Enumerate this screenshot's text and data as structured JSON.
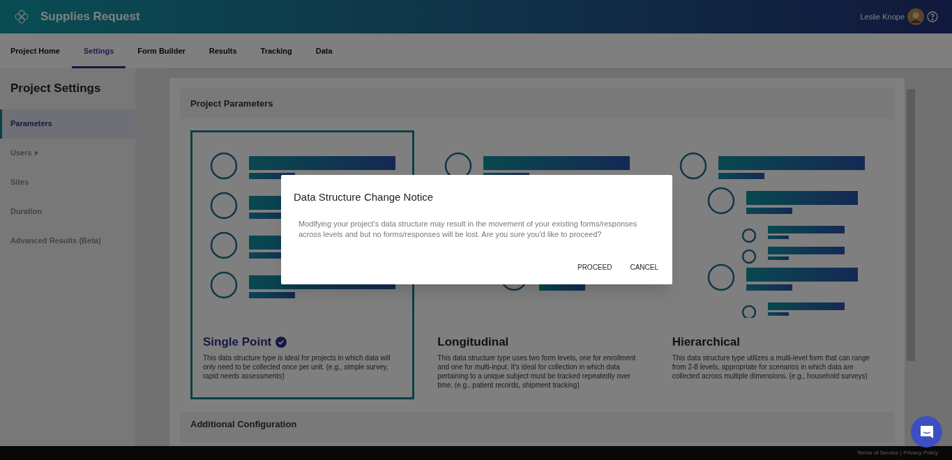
{
  "app": {
    "title": "Supplies Request",
    "user": "Leslie Knope"
  },
  "tabs": [
    {
      "label": "Project Home",
      "selected": false
    },
    {
      "label": "Settings",
      "selected": true
    },
    {
      "label": "Form Builder",
      "selected": false
    },
    {
      "label": "Results",
      "selected": false
    },
    {
      "label": "Tracking",
      "selected": false
    },
    {
      "label": "Data",
      "selected": false
    }
  ],
  "sidebar": {
    "title": "Project Settings",
    "items": [
      {
        "label": "Parameters",
        "selected": true,
        "has_submenu": false
      },
      {
        "label": "Users",
        "selected": false,
        "has_submenu": true
      },
      {
        "label": "Sites",
        "selected": false,
        "has_submenu": false
      },
      {
        "label": "Duration",
        "selected": false,
        "has_submenu": false
      },
      {
        "label": "Advanced Results (Beta)",
        "selected": false,
        "has_submenu": false
      }
    ]
  },
  "section_title": "Project Parameters",
  "structures": [
    {
      "kind": "single",
      "title": "Single Point",
      "selected": true,
      "description": "This data structure type is ideal for projects in which data will only need to be collected once per unit. (e.g., simple survey, rapid needs assessments)"
    },
    {
      "kind": "longitudinal",
      "title": "Longitudinal",
      "selected": false,
      "description": "This data structure type uses two form levels, one for enrollment and one for multi-input. It's ideal for collection in which data pertaining to a unique subject must be tracked repeatedly over time. (e.g., patient records, shipment tracking)"
    },
    {
      "kind": "hierarchical",
      "title": "Hierarchical",
      "selected": false,
      "description": "This data structure type utilizes a multi-level form that can range from 2-8 levels, appropriate for scenarios in which data are collected across multiple dimensions. (e.g., household surveys)"
    }
  ],
  "next_section_title": "Additional Configuration",
  "dialog": {
    "title": "Data Structure Change Notice",
    "message": "Modifying your project’s data structure may result in the movement of your existing forms/responses across levels and but no forms/responses will be lost. Are you sure you'd like to proceed?",
    "buttons": [
      "PROCEED",
      "CANCEL"
    ]
  },
  "footer_links": [
    "Terms of Service",
    "Privacy Policy"
  ]
}
